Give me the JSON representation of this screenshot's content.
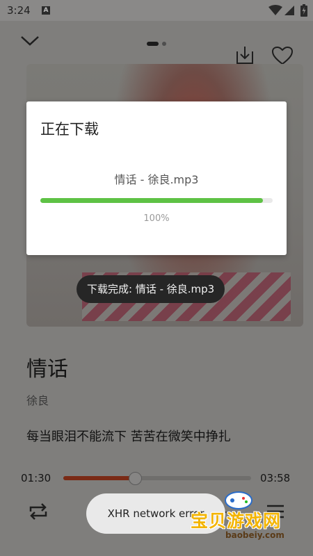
{
  "status_bar": {
    "time": "3:24",
    "app_badge": "A"
  },
  "player": {
    "song_title": "情话",
    "artist": "徐良",
    "lyric": "每当眼泪不能流下 苦苦在微笑中挣扎",
    "current_time": "01:30",
    "total_time": "03:58",
    "progress_fraction": 0.377
  },
  "download_dialog": {
    "title": "正在下载",
    "file_name": "情话 - 徐良.mp3",
    "percent_label": "100%",
    "progress_fraction": 1.0,
    "accent_color": "#5ec245"
  },
  "toasts": {
    "download_complete": "下载完成: 情话 - 徐良.mp3",
    "error": "XHR network error"
  },
  "watermark": {
    "text": "宝贝游戏网",
    "url": "baobeiy.com"
  },
  "icons": [
    "chevron-down-icon",
    "download-icon",
    "heart-icon",
    "repeat-icon",
    "previous-icon",
    "play-pause-icon",
    "next-icon",
    "playlist-icon",
    "wifi-icon",
    "signal-icon",
    "battery-icon"
  ]
}
